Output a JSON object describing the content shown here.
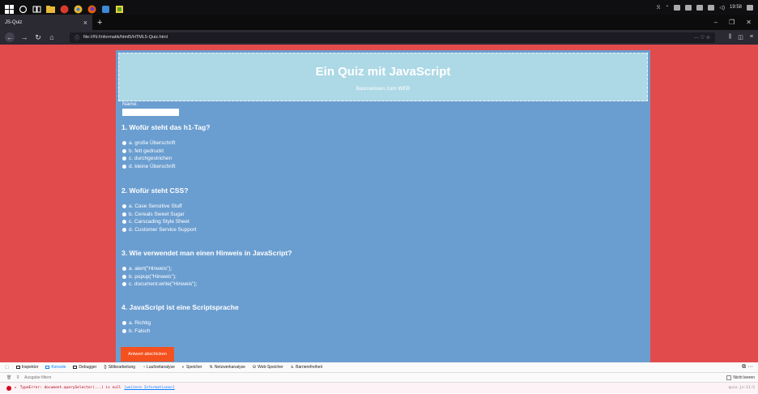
{
  "taskbar": {
    "clock": "19:58"
  },
  "browser": {
    "tab_title": "JS-Quiz",
    "tab_close": "×",
    "new_tab": "+",
    "url": "file:///N:/Informatik/html5/HTML5-Quiz.html",
    "url_actions": "··· ♡ ☆"
  },
  "quiz": {
    "title": "Ein Quiz mit JavaScript",
    "subtitle": "Basiswissen zum WEB",
    "name_label": "Name:",
    "name_value": "",
    "questions": [
      {
        "title": "1. Wofür steht das h1-Tag?",
        "answers": [
          "a. große Überschrift",
          "b. fett gedruckt",
          "c. durchgestrichen",
          "d. kleine Überschrift"
        ]
      },
      {
        "title": "2. Wofür steht CSS?",
        "answers": [
          "a. Case Sensitive Stuff",
          "b. Cereals Sweet Sugar",
          "c. Carscading Style Sheet",
          "d. Customer Service Support"
        ]
      },
      {
        "title": "3. Wie verwendet man einen Hinweis in JavaScript?",
        "answers": [
          "a. alert(\"Hinweis\");",
          "b. popup(\"Hinweis\");",
          "c. document.write(\"Hinweis\");"
        ]
      },
      {
        "title": "4. JavaScript ist eine Scriptsprache",
        "answers": [
          "a. Richtig",
          "b. Falsch"
        ]
      }
    ],
    "submit_label": "Antwort abschicken"
  },
  "devtools": {
    "tabs": [
      "Inspektor",
      "Konsole",
      "Debugger",
      "Stilbearbeitung",
      "Laufzeitanalyse",
      "Speicher",
      "Netzwerkanalyse",
      "Web-Speicher",
      "Barrierefreiheit"
    ],
    "filter_placeholder": "Ausgabe filtern",
    "persist_label": "Nicht leeren",
    "error_text": "TypeError: document.querySelector(...) is null",
    "error_more": "[weitere Informationen]",
    "error_source": "quiz.js:11:5"
  },
  "colors": {
    "page_bg": "#e14b4b",
    "quiz_bg": "#6b9ed0",
    "header_bg": "#add8e6",
    "button_bg": "#f4511e"
  }
}
